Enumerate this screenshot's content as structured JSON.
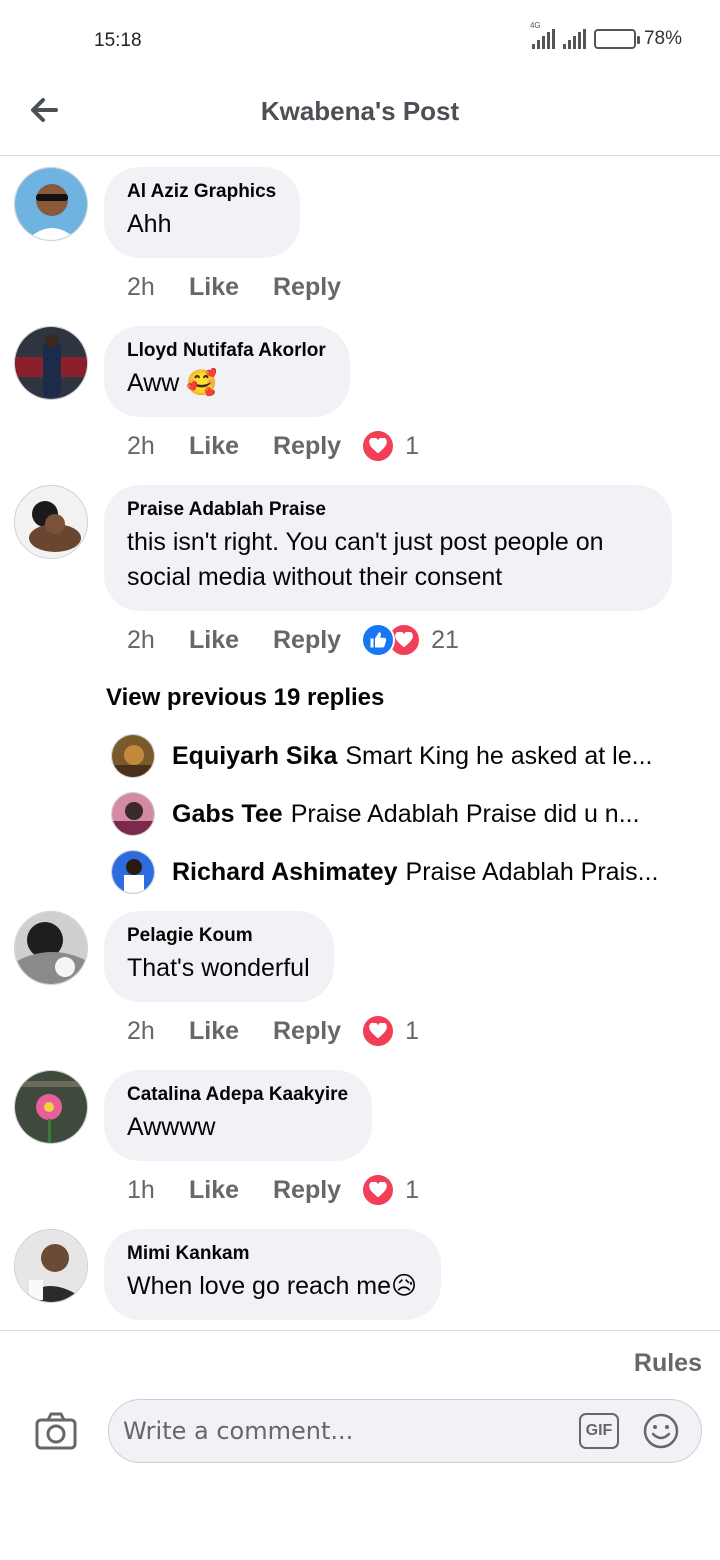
{
  "status_bar": {
    "time": "15:18",
    "network": "4G",
    "battery": "78%",
    "battery_level": 0.78
  },
  "header": {
    "title": "Kwabena's Post",
    "back_icon": "back-arrow-icon"
  },
  "comments": [
    {
      "author": "Al Aziz Graphics",
      "text": "Ahh",
      "time": "2h",
      "like": "Like",
      "reply": "Reply",
      "reaction_count": ""
    },
    {
      "author": "Lloyd Nutifafa Akorlor",
      "text": "Aww 🥰",
      "time": "2h",
      "like": "Like",
      "reply": "Reply",
      "reaction_count": "1"
    },
    {
      "author": "Praise Adablah Praise",
      "text": "this isn't right. You can't just post people on social media without their consent",
      "time": "2h",
      "like": "Like",
      "reply": "Reply",
      "reaction_count": "21"
    },
    {
      "author": "Pelagie Koum",
      "text": "That's wonderful",
      "time": "2h",
      "like": "Like",
      "reply": "Reply",
      "reaction_count": "1"
    },
    {
      "author": "Catalina Adepa Kaakyire",
      "text": "Awwww",
      "time": "1h",
      "like": "Like",
      "reply": "Reply",
      "reaction_count": "1"
    },
    {
      "author": "Mimi Kankam",
      "text": "When love go reach me😥"
    }
  ],
  "view_previous": "View previous 19 replies",
  "replies": [
    {
      "name": "Equiyarh Sika",
      "text": "Smart King he asked at le..."
    },
    {
      "name": "Gabs Tee",
      "text": "Praise Adablah Praise did u n..."
    },
    {
      "name": "Richard Ashimatey",
      "text": "Praise Adablah Prais..."
    }
  ],
  "composer": {
    "rules": "Rules",
    "placeholder": "Write a comment...",
    "gif": "GIF"
  },
  "colors": {
    "bubble": "#f0f2f5",
    "muted": "#65676b",
    "love": "#f33e58",
    "like": "#1877f2"
  }
}
